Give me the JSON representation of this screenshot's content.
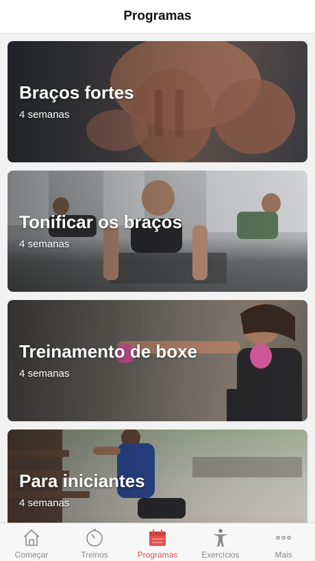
{
  "header": {
    "title": "Programas"
  },
  "programs": [
    {
      "title": "Braços fortes",
      "duration": "4 semanas"
    },
    {
      "title": "Tonificar os braços",
      "duration": "4 semanas"
    },
    {
      "title": "Treinamento de boxe",
      "duration": "4 semanas"
    },
    {
      "title": "Para iniciantes",
      "duration": "4 semanas"
    }
  ],
  "tabbar": {
    "tabs": [
      {
        "label": "Começar",
        "icon": "home-icon"
      },
      {
        "label": "Treinos",
        "icon": "stopwatch-icon"
      },
      {
        "label": "Programas",
        "icon": "calendar-icon"
      },
      {
        "label": "Exercícios",
        "icon": "person-icon"
      },
      {
        "label": "Mais",
        "icon": "more-dots-icon"
      }
    ],
    "active_index": 2
  },
  "colors": {
    "accent": "#e5514f",
    "inactive": "#888888",
    "background": "#f2f2f2"
  }
}
